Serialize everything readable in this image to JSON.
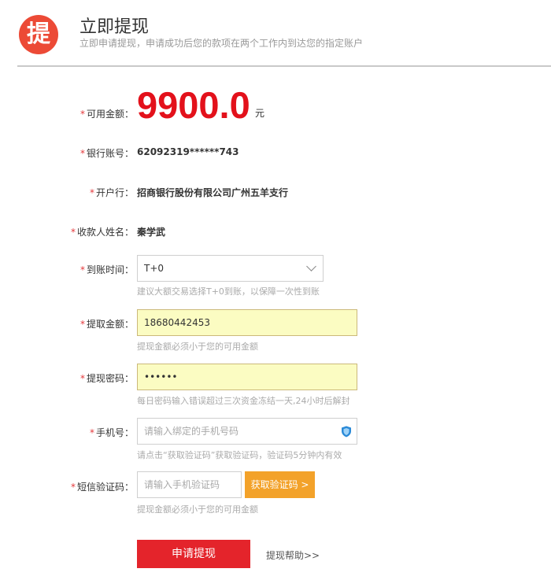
{
  "header": {
    "logo_char": "提",
    "title": "立即提现",
    "subtitle": "立即申请提现，申请成功后您的款项在两个工作内到达您的指定账户"
  },
  "form": {
    "available": {
      "label": "可用金额：",
      "amount": "9900.0",
      "unit": "元"
    },
    "bank_account": {
      "label": "银行账号：",
      "value": "62092319******743"
    },
    "bank_branch": {
      "label": "开户行：",
      "value": "招商银行股份有限公司广州五羊支行"
    },
    "payee": {
      "label": "收款人姓名：",
      "value": "秦学武"
    },
    "arrival_time": {
      "label": "到账时间：",
      "selected": "T+0",
      "hint": "建议大额交易选择T+0到账，以保障一次性到账"
    },
    "withdraw_amount": {
      "label": "提取金额：",
      "value": "18680442453",
      "hint": "提现金额必须小于您的可用金额"
    },
    "withdraw_password": {
      "label": "提现密码：",
      "value": "••••••",
      "hint": "每日密码输入错误超过三次资金冻结一天,24小时后解封"
    },
    "phone": {
      "label": "手机号：",
      "placeholder": "请输入绑定的手机号码",
      "hint": "请点击“获取验证码”获取验证码，验证码5分钟内有效"
    },
    "sms_code": {
      "label": "短信验证码：",
      "placeholder": "请输入手机验证码",
      "button": "获取验证码 >",
      "hint": "提现金额必须小于您的可用金额"
    },
    "required_mark": "*"
  },
  "actions": {
    "submit": "申请提现",
    "help": "提现帮助>>"
  },
  "colors": {
    "accent_red": "#e3111b",
    "logo": "#ec4a36",
    "code_button": "#f3a22a",
    "filled_field": "#fbfcc2"
  },
  "icons": {
    "arrival_dropdown": "chevron-down-icon",
    "phone_field": "shield-icon"
  }
}
